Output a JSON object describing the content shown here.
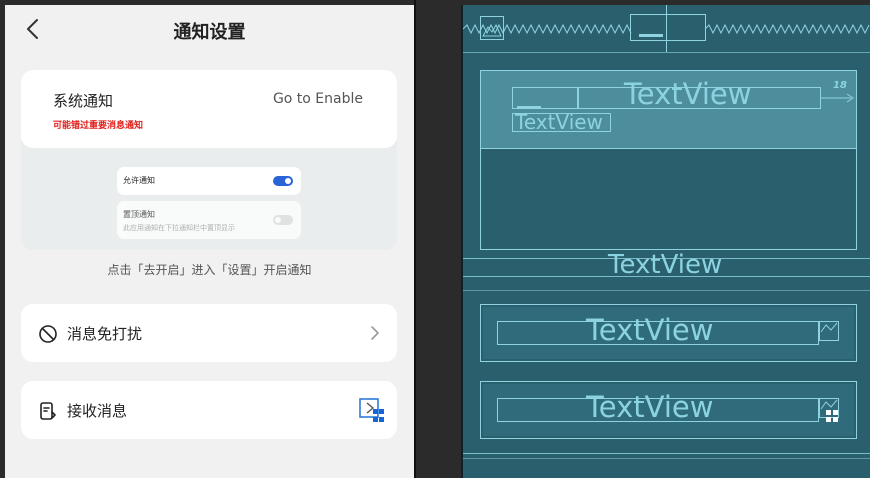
{
  "header": {
    "title": "通知设置"
  },
  "notification_card": {
    "title": "系统通知",
    "subtitle": "可能错过重要消息通知",
    "enable_label": "Go to Enable",
    "preview": {
      "allow_label": "允许通知",
      "pin_label": "置顶通知",
      "pin_desc": "此应用通知在下拉通知栏中置顶显示"
    }
  },
  "hint": "点击「去开启」进入「设置」开启通知",
  "rows": [
    {
      "label": "消息免打扰",
      "icon": "do-not-disturb-icon",
      "trailing": "chevron-right-icon"
    },
    {
      "label": "接收消息",
      "icon": "receive-message-icon",
      "trailing": "image-placeholder-icon"
    }
  ],
  "blueprint": {
    "textview_label": "TextView",
    "badge_number": "18"
  },
  "colors": {
    "design_background": "#f1f1f1",
    "card": "#ffffff",
    "warning_text": "#e0201c",
    "toggle_on": "#2b64d6",
    "blueprint_background": "#2a5f6e",
    "blueprint_line": "#8fd3e0"
  }
}
